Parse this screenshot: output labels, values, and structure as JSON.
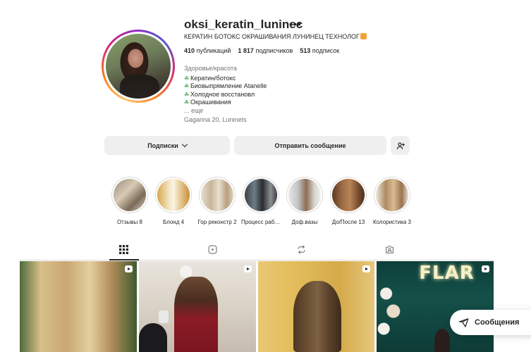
{
  "profile": {
    "username": "oksi_keratin_luninec",
    "more_icon": "•••",
    "full_name": "КЕРАТИН БОТОКС ОКРАШИВАНИЯ ЛУНИНЕЦ ТЕХНОЛОГ",
    "stats": [
      {
        "value": "410",
        "label": "публикаций"
      },
      {
        "value": "1 817",
        "label": "подписчиков"
      },
      {
        "value": "513",
        "label": "подписок"
      }
    ],
    "bio": {
      "category": "Здоровье/красота",
      "lines": [
        "Кератин/ботокс",
        "Биовыпрямление Atanelle",
        "Холодное восстановл",
        "Окрашивания"
      ],
      "more": "... еще",
      "address": "Gagarina 20, Luninets"
    }
  },
  "actions": {
    "following_label": "Подписки",
    "message_label": "Отправить сообщение"
  },
  "highlights": [
    {
      "label": "Отзывы 8"
    },
    {
      "label": "Блонд 4"
    },
    {
      "label": "Гор реконстр 2"
    },
    {
      "label": "Процесс работы"
    },
    {
      "label": "Доф.вазы"
    },
    {
      "label": "До/После 13"
    },
    {
      "label": "Колористика 3"
    }
  ],
  "tabs": [
    {
      "name": "posts",
      "icon": "grid-icon",
      "active": true
    },
    {
      "name": "reels",
      "icon": "reels-icon",
      "active": false
    },
    {
      "name": "reposts",
      "icon": "repost-icon",
      "active": false
    },
    {
      "name": "tagged",
      "icon": "tagged-icon",
      "active": false
    }
  ],
  "posts": [
    {
      "type": "reel"
    },
    {
      "type": "reel"
    },
    {
      "type": "reel"
    },
    {
      "type": "reel",
      "overlay_text": "FLAR"
    }
  ],
  "messages_pill": {
    "label": "Сообщения"
  }
}
